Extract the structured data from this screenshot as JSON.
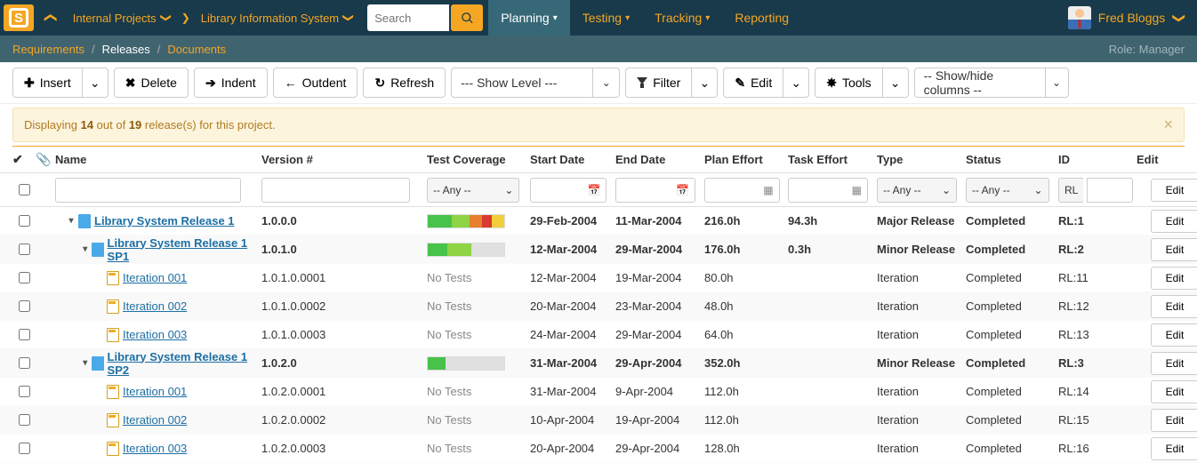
{
  "nav": {
    "workspace": "Internal Projects",
    "project": "Library Information System",
    "search_placeholder": "Search",
    "menus": [
      {
        "label": "Planning",
        "selected": true,
        "caret": true
      },
      {
        "label": "Testing",
        "selected": false,
        "caret": true
      },
      {
        "label": "Tracking",
        "selected": false,
        "caret": true
      },
      {
        "label": "Reporting",
        "selected": false,
        "caret": false
      }
    ],
    "user_name": "Fred Bloggs"
  },
  "breadcrumb": {
    "items": [
      {
        "label": "Requirements",
        "active": false
      },
      {
        "label": "Releases",
        "active": true
      },
      {
        "label": "Documents",
        "active": false
      }
    ],
    "role_label": "Role: Manager"
  },
  "toolbar": {
    "insert": "Insert",
    "delete": "Delete",
    "indent": "Indent",
    "outdent": "Outdent",
    "refresh": "Refresh",
    "show_level": "--- Show Level ---",
    "filter": "Filter",
    "edit": "Edit",
    "tools": "Tools",
    "show_hide": "-- Show/hide columns --"
  },
  "banner": {
    "pre": "Displaying ",
    "shown": "14",
    "mid": " out of ",
    "total": "19",
    "post": " release(s) for this project."
  },
  "columns": {
    "name": "Name",
    "version": "Version #",
    "coverage": "Test Coverage",
    "start": "Start Date",
    "end": "End Date",
    "plan": "Plan Effort",
    "task": "Task Effort",
    "type": "Type",
    "status": "Status",
    "id": "ID",
    "edit": "Edit"
  },
  "filters": {
    "any": "-- Any --",
    "id_prefix": "RL",
    "edit_btn": "Edit"
  },
  "rows": [
    {
      "indent": 0,
      "expandable": true,
      "bold": true,
      "icon": "rel",
      "name": "Library System Release 1",
      "version": "1.0.0.0",
      "coverage": [
        [
          "#47c24a",
          28
        ],
        [
          "#8ed444",
          20
        ],
        [
          "#e87e30",
          14
        ],
        [
          "#d83a2f",
          12
        ],
        [
          "#f2cf3a",
          14
        ]
      ],
      "start": "29-Feb-2004",
      "end": "11-Mar-2004",
      "plan": "216.0h",
      "task": "94.3h",
      "type": "Major Release",
      "status": "Completed",
      "id": "RL:1",
      "alt": false
    },
    {
      "indent": 1,
      "expandable": true,
      "bold": true,
      "icon": "sub",
      "name": "Library System Release 1 SP1",
      "version": "1.0.1.0",
      "coverage": [
        [
          "#47c24a",
          22
        ],
        [
          "#8ed444",
          28
        ],
        [
          "#e0e0e0",
          38
        ]
      ],
      "start": "12-Mar-2004",
      "end": "29-Mar-2004",
      "plan": "176.0h",
      "task": "0.3h",
      "type": "Minor Release",
      "status": "Completed",
      "id": "RL:2",
      "alt": true
    },
    {
      "indent": 2,
      "expandable": false,
      "bold": false,
      "icon": "iter",
      "name": "Iteration 001",
      "version": "1.0.1.0.0001",
      "coverage": null,
      "notest": "No Tests",
      "start": "12-Mar-2004",
      "end": "19-Mar-2004",
      "plan": "80.0h",
      "task": "",
      "type": "Iteration",
      "status": "Completed",
      "id": "RL:11",
      "alt": false
    },
    {
      "indent": 2,
      "expandable": false,
      "bold": false,
      "icon": "iter",
      "name": "Iteration 002",
      "version": "1.0.1.0.0002",
      "coverage": null,
      "notest": "No Tests",
      "start": "20-Mar-2004",
      "end": "23-Mar-2004",
      "plan": "48.0h",
      "task": "",
      "type": "Iteration",
      "status": "Completed",
      "id": "RL:12",
      "alt": true
    },
    {
      "indent": 2,
      "expandable": false,
      "bold": false,
      "icon": "iter",
      "name": "Iteration 003",
      "version": "1.0.1.0.0003",
      "coverage": null,
      "notest": "No Tests",
      "start": "24-Mar-2004",
      "end": "29-Mar-2004",
      "plan": "64.0h",
      "task": "",
      "type": "Iteration",
      "status": "Completed",
      "id": "RL:13",
      "alt": false
    },
    {
      "indent": 1,
      "expandable": true,
      "bold": true,
      "icon": "sub",
      "name": "Library System Release 1 SP2",
      "version": "1.0.2.0",
      "coverage": [
        [
          "#47c24a",
          20
        ],
        [
          "#e0e0e0",
          68
        ]
      ],
      "start": "31-Mar-2004",
      "end": "29-Apr-2004",
      "plan": "352.0h",
      "task": "",
      "type": "Minor Release",
      "status": "Completed",
      "id": "RL:3",
      "alt": true
    },
    {
      "indent": 2,
      "expandable": false,
      "bold": false,
      "icon": "iter",
      "name": "Iteration 001",
      "version": "1.0.2.0.0001",
      "coverage": null,
      "notest": "No Tests",
      "start": "31-Mar-2004",
      "end": "9-Apr-2004",
      "plan": "112.0h",
      "task": "",
      "type": "Iteration",
      "status": "Completed",
      "id": "RL:14",
      "alt": false
    },
    {
      "indent": 2,
      "expandable": false,
      "bold": false,
      "icon": "iter",
      "name": "Iteration 002",
      "version": "1.0.2.0.0002",
      "coverage": null,
      "notest": "No Tests",
      "start": "10-Apr-2004",
      "end": "19-Apr-2004",
      "plan": "112.0h",
      "task": "",
      "type": "Iteration",
      "status": "Completed",
      "id": "RL:15",
      "alt": true
    },
    {
      "indent": 2,
      "expandable": false,
      "bold": false,
      "icon": "iter",
      "name": "Iteration 003",
      "version": "1.0.2.0.0003",
      "coverage": null,
      "notest": "No Tests",
      "start": "20-Apr-2004",
      "end": "29-Apr-2004",
      "plan": "128.0h",
      "task": "",
      "type": "Iteration",
      "status": "Completed",
      "id": "RL:16",
      "alt": false
    }
  ]
}
